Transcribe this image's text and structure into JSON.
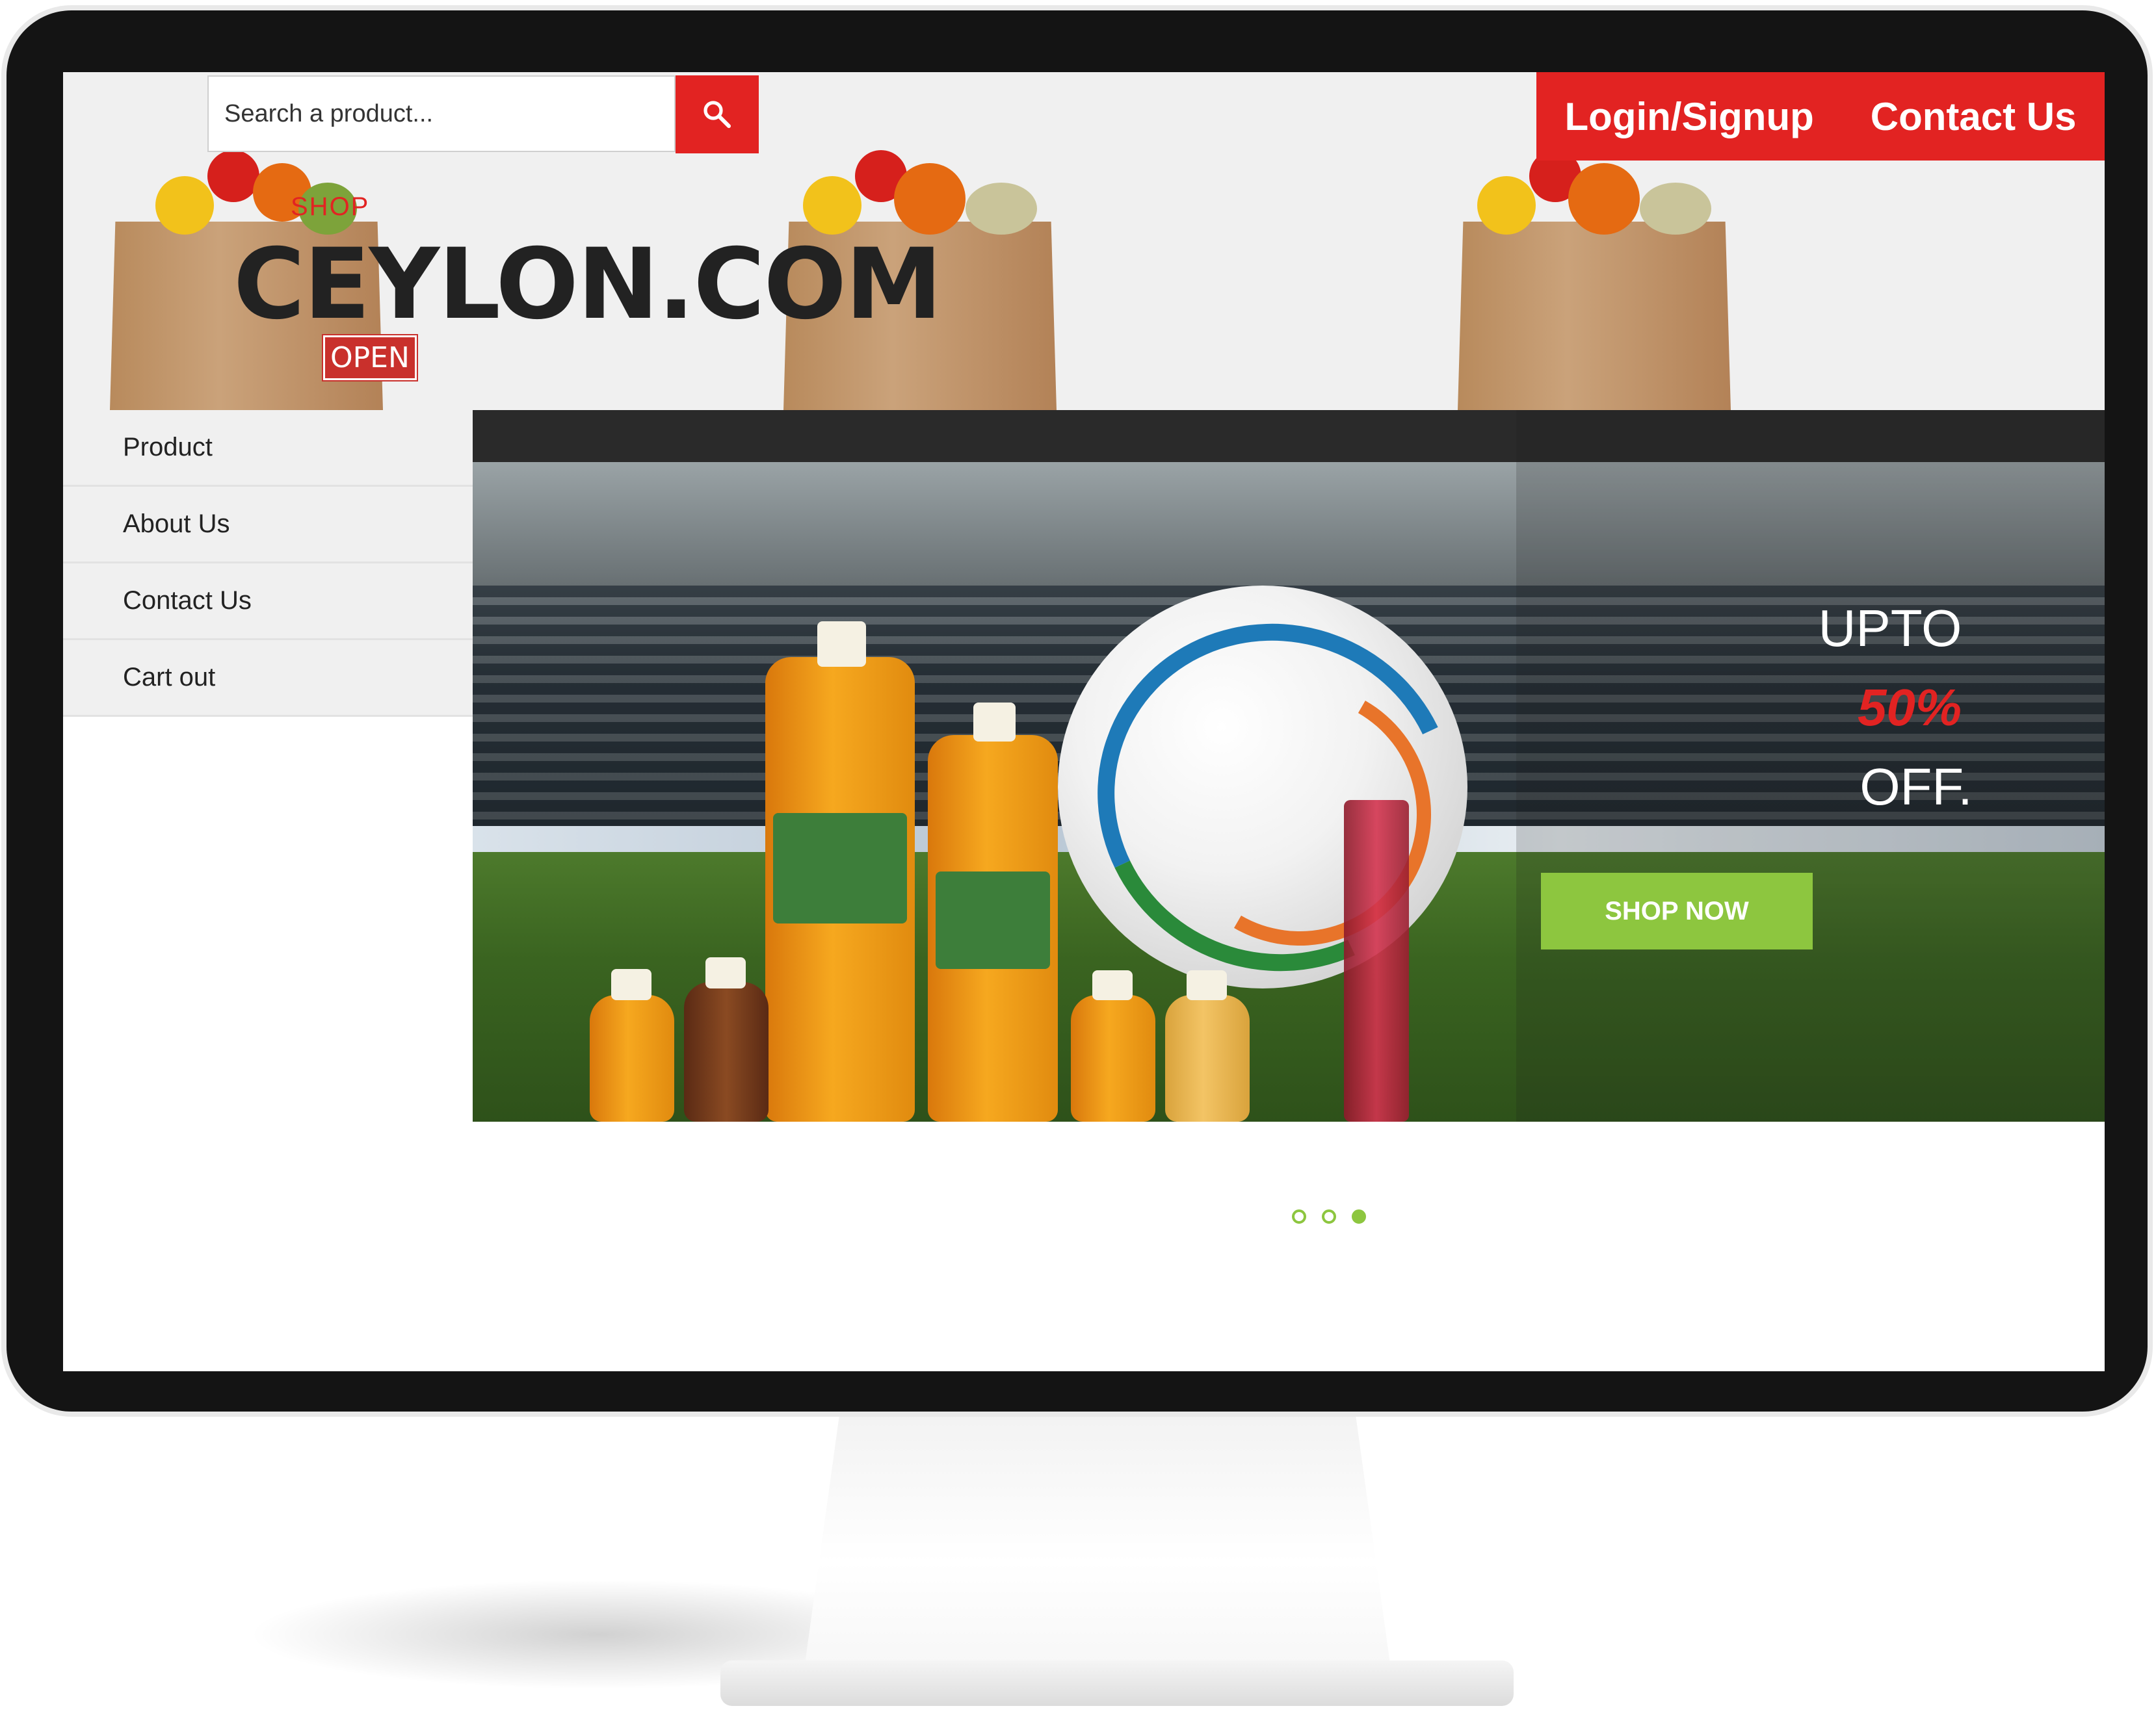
{
  "search": {
    "placeholder": "Search a product..."
  },
  "logo": {
    "shop": "SHOP",
    "name": "CEYLON.COM",
    "open": "OPEN"
  },
  "topnav": {
    "login": "Login/Signup",
    "contact": "Contact Us"
  },
  "sidebar": {
    "items": [
      {
        "label": "Product"
      },
      {
        "label": "About Us"
      },
      {
        "label": "Contact Us"
      },
      {
        "label": "Cart out"
      }
    ]
  },
  "banner": {
    "upto": "UPTO",
    "percent": "50%",
    "off": "OFF.",
    "cta": "SHOP NOW"
  },
  "carousel": {
    "slide_count": 3,
    "active_slide": 3
  },
  "colors": {
    "brand_red": "#e22322",
    "accent_green": "#8dc63f"
  }
}
